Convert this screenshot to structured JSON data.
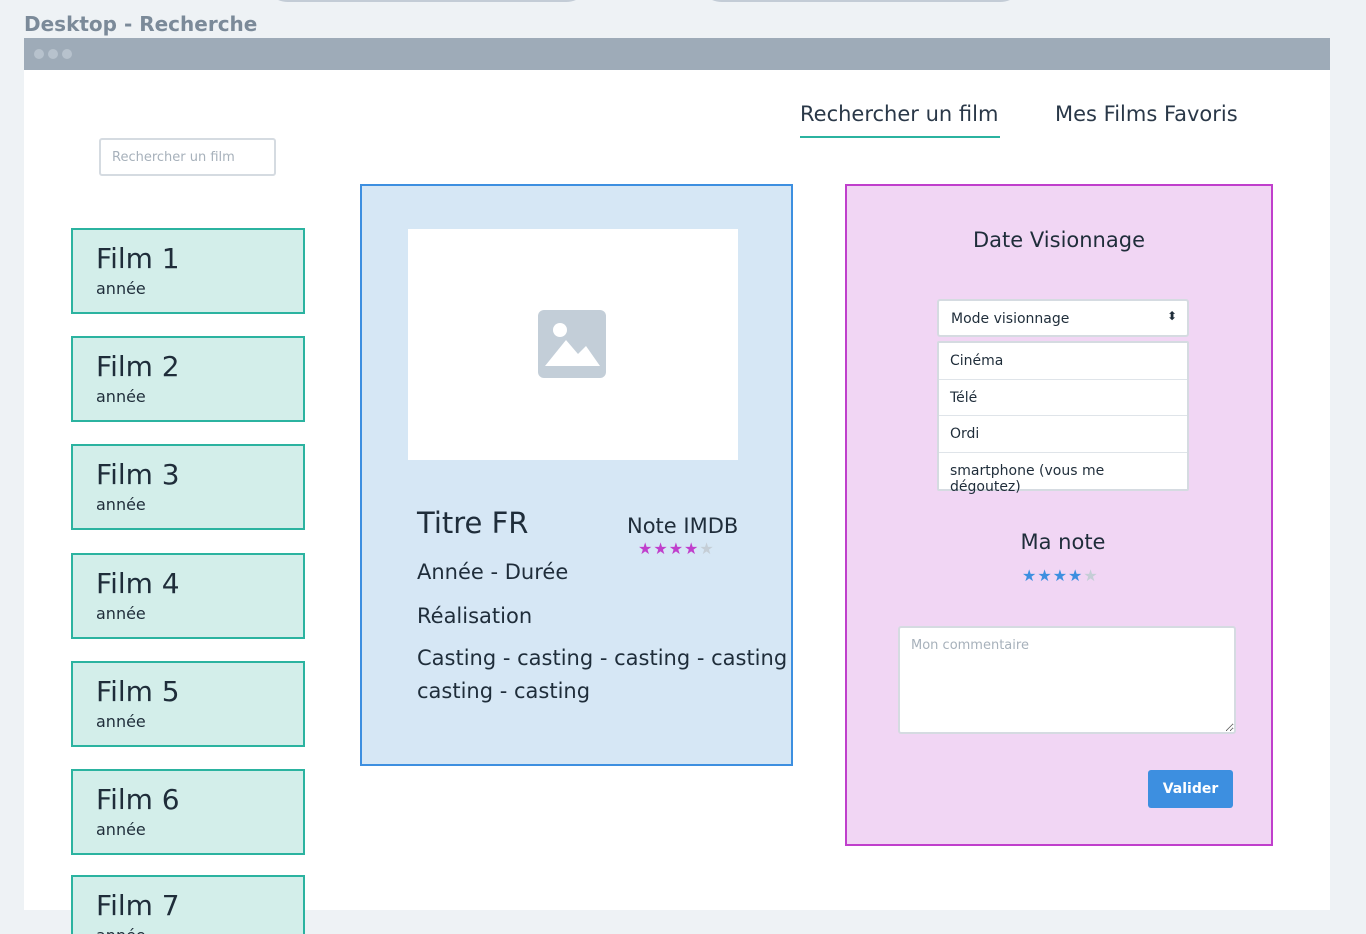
{
  "page": {
    "label": "Desktop - Recherche"
  },
  "nav": {
    "search_tab": "Rechercher un film",
    "favorites_tab": "Mes Films Favoris"
  },
  "search": {
    "placeholder": "Rechercher un film"
  },
  "films": [
    {
      "title": "Film 1",
      "year": "année"
    },
    {
      "title": "Film 2",
      "year": "année"
    },
    {
      "title": "Film 3",
      "year": "année"
    },
    {
      "title": "Film 4",
      "year": "année"
    },
    {
      "title": "Film 5",
      "year": "année"
    },
    {
      "title": "Film 6",
      "year": "année"
    },
    {
      "title": "Film 7",
      "year": "année"
    }
  ],
  "detail": {
    "title": "Titre FR",
    "imdb_label": "Note IMDB",
    "imdb_rating": 4,
    "imdb_max": 5,
    "year_duration": "Année - Durée",
    "director": "Réalisation",
    "casting": "Casting - casting - casting - casting casting - casting",
    "poster_icon": "image-placeholder-icon"
  },
  "watch": {
    "date_label": "Date Visionnage",
    "mode_select": "Mode visionnage",
    "mode_options": [
      "Cinéma",
      "Télé",
      "Ordi",
      "smartphone (vous me dégoutez)"
    ],
    "note_label": "Ma note",
    "my_rating": 4,
    "my_rating_max": 5,
    "comment_placeholder": "Mon commentaire",
    "submit_label": "Valider"
  },
  "colors": {
    "accent_teal": "#2bb3a0",
    "film_card_bg": "#d3eeea",
    "detail_bg": "#d6e7f5",
    "detail_border": "#3d8fe0",
    "watch_bg": "#f1d6f4",
    "watch_border": "#c03fcc",
    "button_blue": "#3d8fe0"
  }
}
